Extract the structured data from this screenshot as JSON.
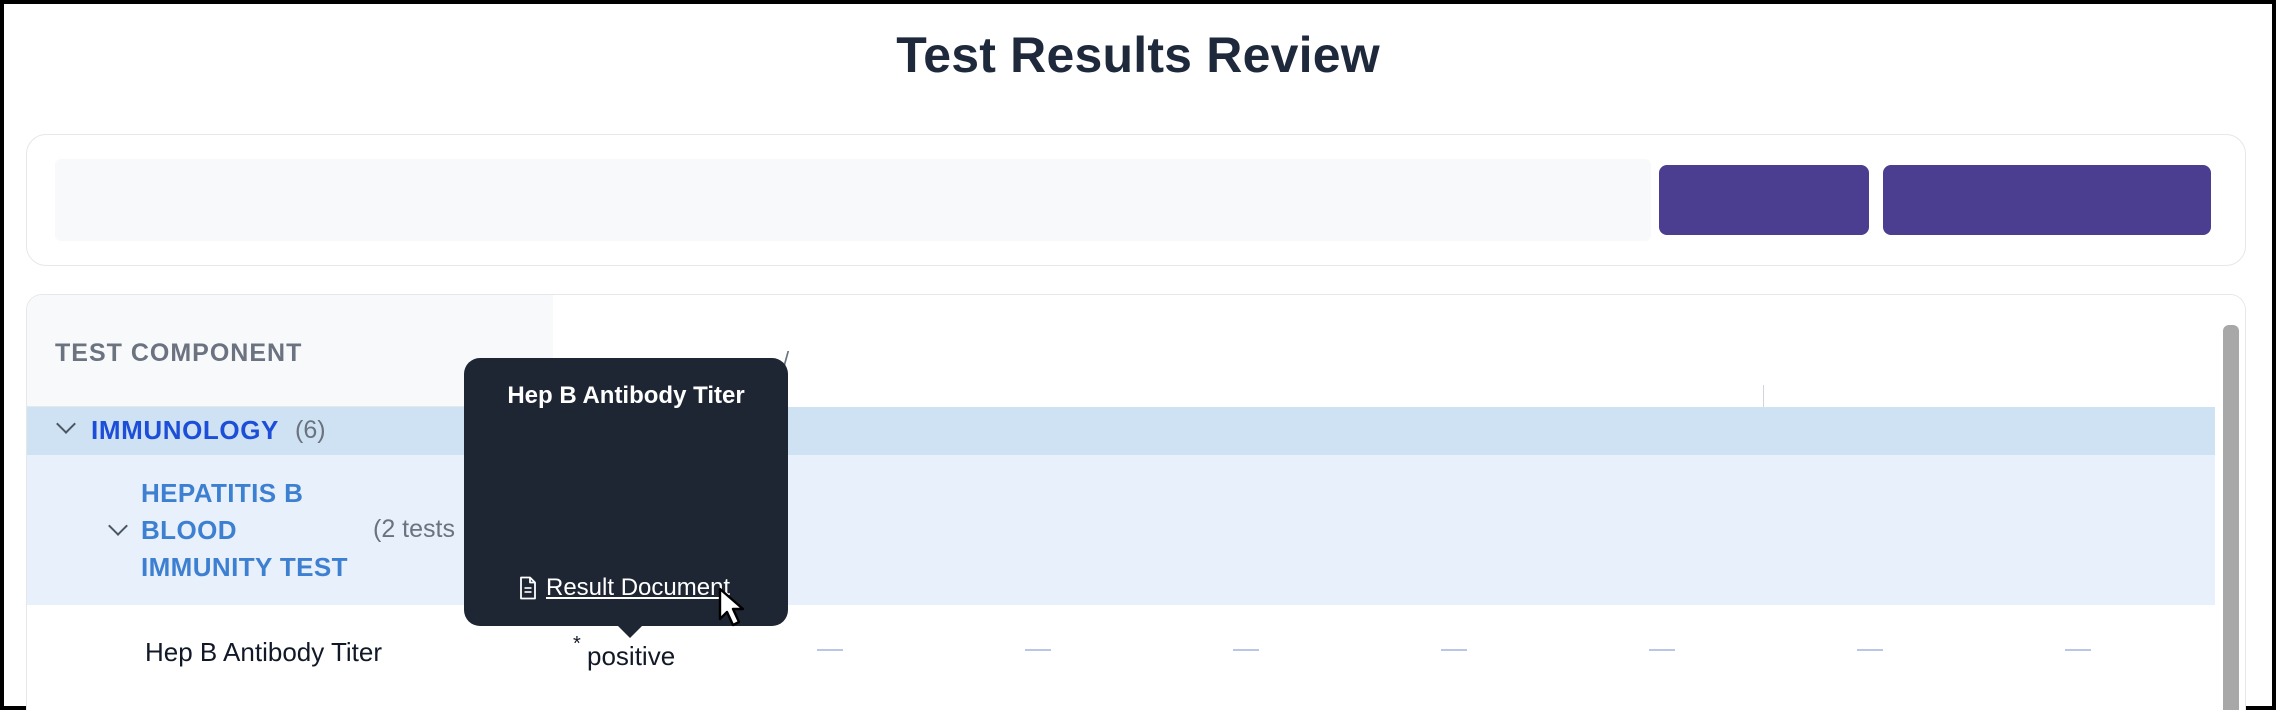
{
  "page": {
    "title": "Test Results Review"
  },
  "toolbar": {
    "search_placeholder": "",
    "button_1_label": "",
    "button_2_label": ""
  },
  "table": {
    "header": {
      "test_component_label": "TEST COMPONENT",
      "column_fragment": "/"
    },
    "group": {
      "label": "IMMUNOLOGY",
      "count": "(6)"
    },
    "subgroup": {
      "label": "HEPATITIS B BLOOD IMMUNITY TEST",
      "count": "(2 tests"
    },
    "rows": [
      {
        "label": "Hep B Antibody Titer",
        "flag": "*",
        "value": "positive",
        "empty_cells": [
          "—",
          "—",
          "—",
          "—",
          "—",
          "—",
          "—"
        ]
      }
    ]
  },
  "tooltip": {
    "title": "Hep B Antibody Titer",
    "link_label": "Result Document"
  },
  "icons": {
    "document": "document-icon",
    "chevron": "chevron-down-icon",
    "cursor": "pointer-cursor-icon"
  },
  "colors": {
    "accent": "#4b3d8f",
    "group_row": "#cfe2f3",
    "subgroup_row": "#e8f0fb",
    "group_text": "#1d4ed8",
    "subgroup_text": "#3d7fd0",
    "tooltip_bg": "#1f2633"
  }
}
